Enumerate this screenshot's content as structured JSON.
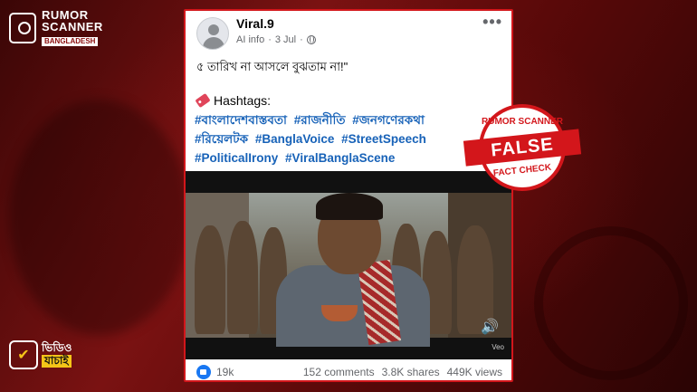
{
  "brand": {
    "line1": "RUMOR",
    "line2": "SCANNER",
    "line3": "BANGLADESH"
  },
  "video_badge": {
    "line1": "ভিডিও",
    "line2": "যাচাই"
  },
  "post": {
    "author": "Viral.9",
    "meta_label": "AI info",
    "date": "3 Jul",
    "more": "•••",
    "text": "৫ তারিখ না আসলে বুঝতাম না!\"",
    "hashtags_heading": "Hashtags:",
    "hashtags": [
      "#বাংলাদেশবাস্তবতা",
      "#রাজনীতি",
      "#জনগণেরকথা",
      "#রিয়েলটক",
      "#BanglaVoice",
      "#StreetSpeech",
      "#PoliticalIrony",
      "#ViralBanglaScene"
    ],
    "video_watermark": "Veo",
    "reactions": "19k",
    "comments": "152 comments",
    "shares": "3.8K shares",
    "views": "449K views"
  },
  "stamp": {
    "top": "RUMOR SCANNER",
    "verdict": "FALSE",
    "bottom": "FACT CHECK"
  },
  "colors": {
    "accent_red": "#d3161b",
    "hashtag_blue": "#1762b8",
    "like_blue": "#1877f2"
  }
}
